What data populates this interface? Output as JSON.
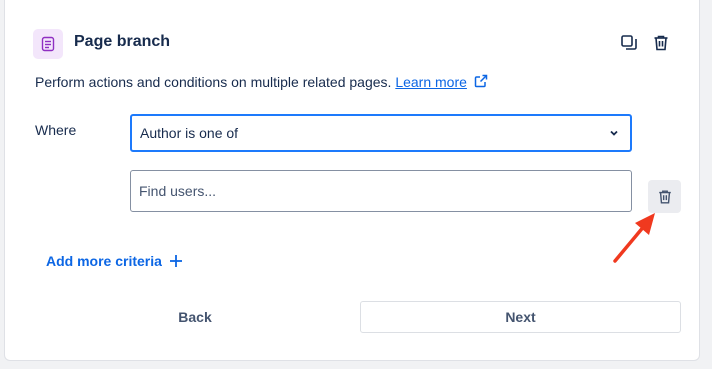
{
  "header": {
    "title": "Page branch",
    "icon": "page-icon",
    "icon_bg": "#f3e6fb",
    "icon_color": "#8f2fc2",
    "actions": [
      {
        "name": "duplicate-icon"
      },
      {
        "name": "delete-icon"
      }
    ]
  },
  "description": {
    "text": "Perform actions and conditions on multiple related pages.",
    "link_label": "Learn more",
    "link_icon": "external-link-icon"
  },
  "condition": {
    "label": "Where",
    "select_value": "Author is one of",
    "input_placeholder": "Find users...",
    "input_value": "",
    "remove_icon": "trash-icon"
  },
  "add_criteria": {
    "label": "Add more criteria",
    "icon": "plus-icon"
  },
  "footer": {
    "back_label": "Back",
    "next_label": "Next"
  },
  "annotation": {
    "arrow_color": "#f0391f",
    "points_to": "trash-button"
  },
  "colors": {
    "accent": "#1d7afc",
    "link": "#0c66e4",
    "text": "#172b4d"
  }
}
